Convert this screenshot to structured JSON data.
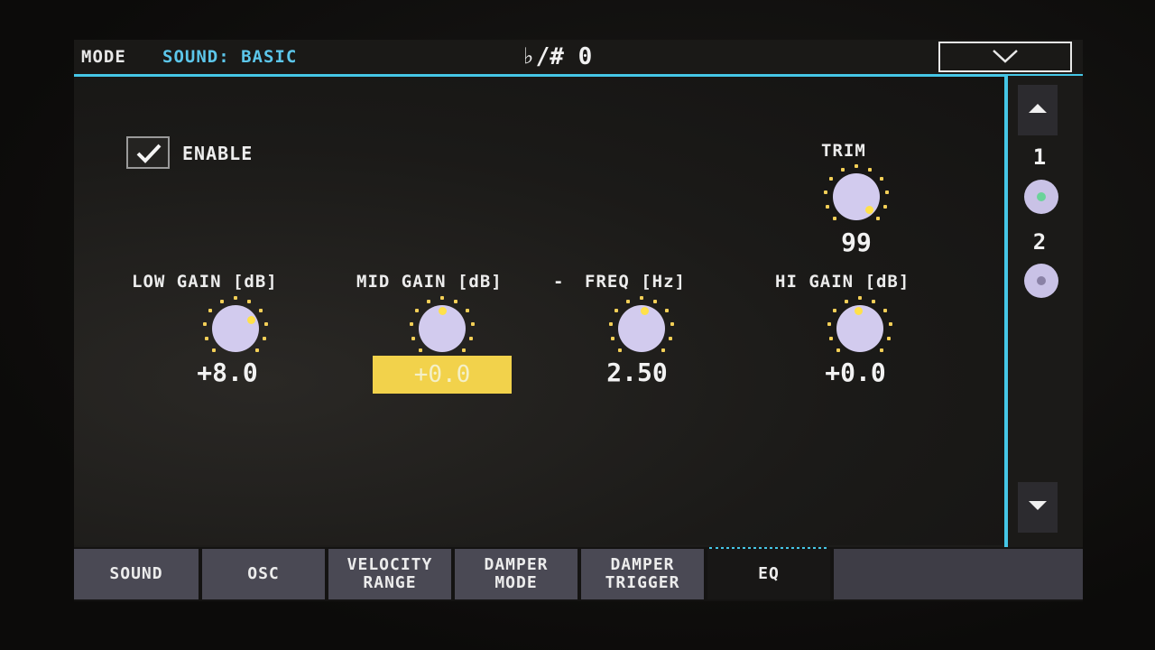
{
  "header": {
    "mode_label": "MODE",
    "mode_value": "SOUND: BASIC",
    "transpose": "♭/# 0"
  },
  "enable": {
    "label": "ENABLE",
    "checked": true
  },
  "trim": {
    "label": "TRIM",
    "value": "99"
  },
  "params": [
    {
      "label": "LOW GAIN [dB]",
      "value": "+8.0"
    },
    {
      "label": "MID GAIN [dB]",
      "value": "+0.0"
    },
    {
      "label": "-",
      "value": ""
    },
    {
      "label": "FREQ [Hz]",
      "value": "2.50"
    },
    {
      "label": "HI GAIN [dB]",
      "value": "+0.0"
    }
  ],
  "pages": [
    "1",
    "2"
  ],
  "tabs": [
    {
      "label": "SOUND"
    },
    {
      "label": "OSC"
    },
    {
      "label": "VELOCITY\nRANGE"
    },
    {
      "label": "DAMPER\nMODE"
    },
    {
      "label": "DAMPER\nTRIGGER"
    },
    {
      "label": "EQ",
      "active": true
    }
  ],
  "colors": {
    "accent": "#45c6e6",
    "knob": "#d2cbee",
    "selected": "#f2d24b",
    "tab": "#4a4954"
  }
}
